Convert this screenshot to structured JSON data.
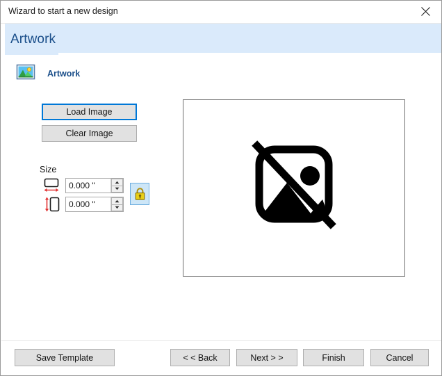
{
  "window": {
    "title": "Wizard to start a new design",
    "close_icon": "close-icon"
  },
  "header": {
    "title": "Artwork"
  },
  "section": {
    "icon": "picture-icon",
    "label": "Artwork"
  },
  "actions": {
    "load_image": "Load Image",
    "clear_image": "Clear Image"
  },
  "size": {
    "group_label": "Size",
    "width": {
      "icon": "width-dimension-icon",
      "value": "0.000 \"",
      "spin_up_icon": "spinner-up-icon",
      "spin_down_icon": "spinner-down-icon"
    },
    "height": {
      "icon": "height-dimension-icon",
      "value": "0.000 \"",
      "spin_up_icon": "spinner-up-icon",
      "spin_down_icon": "spinner-down-icon"
    },
    "lock": {
      "icon": "lock-closed-icon",
      "state": "locked"
    }
  },
  "preview": {
    "placeholder_icon": "no-image-icon"
  },
  "footer": {
    "save_template": "Save Template",
    "back": "< < Back",
    "next": "Next > >",
    "finish": "Finish",
    "cancel": "Cancel"
  },
  "colors": {
    "header_band": "#daeafb",
    "header_text": "#1b4f8a",
    "accent_focus": "#0078d7",
    "button_face": "#e1e1e1",
    "lock_highlight": "#cde6f7"
  }
}
